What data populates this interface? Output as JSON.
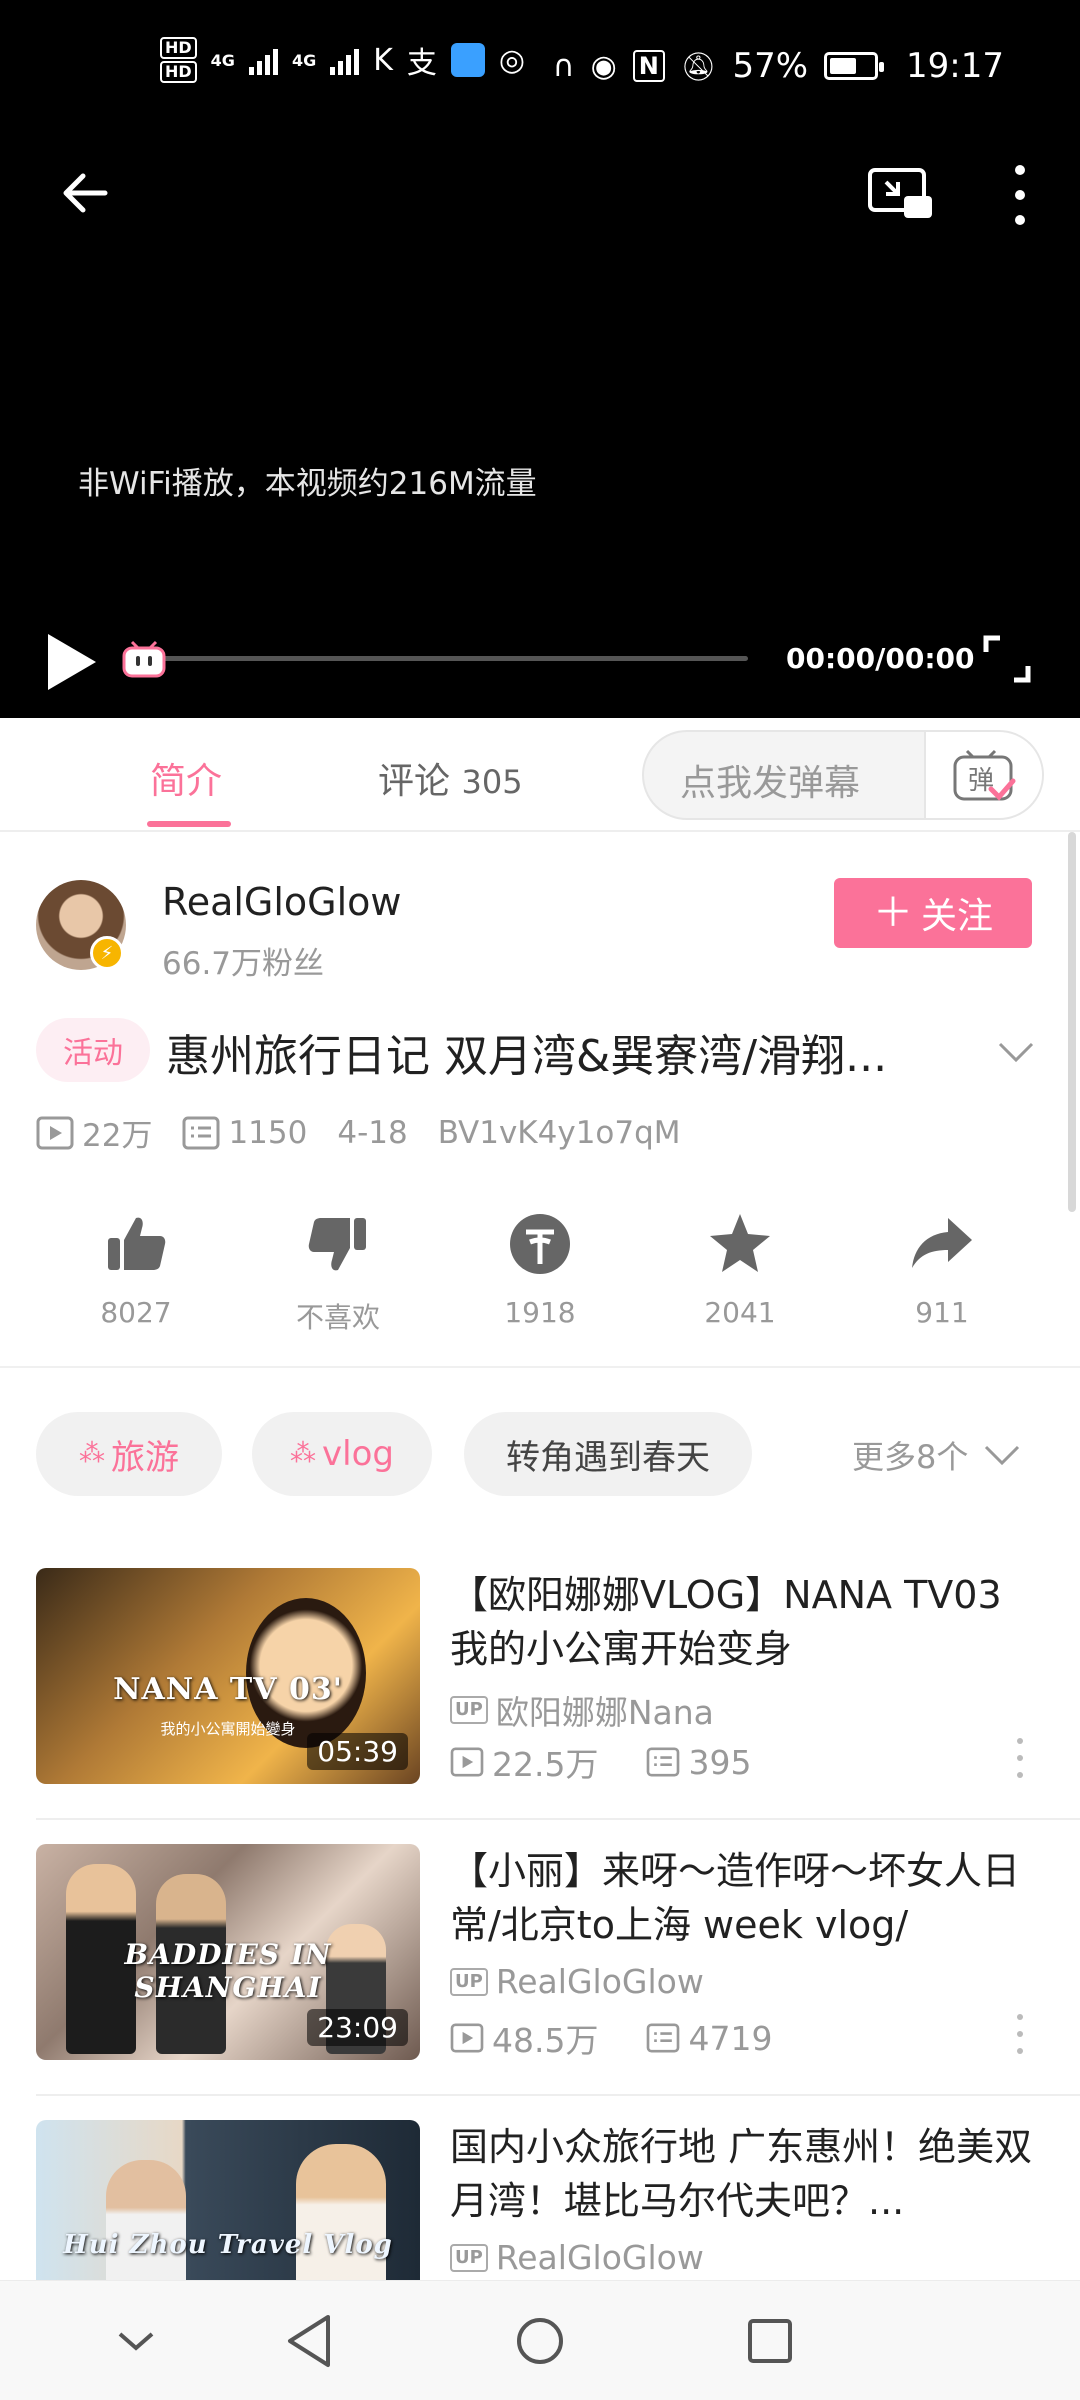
{
  "status_bar": {
    "network_labels": [
      "4G",
      "4G"
    ],
    "battery_percent": "57%",
    "time": "19:17"
  },
  "player": {
    "network_notice": "非WiFi播放，本视频约216M流量",
    "time_display": "00:00/00:00",
    "progress": 0
  },
  "tabs": {
    "intro_label": "简介",
    "comments_label": "评论",
    "comments_count": "305",
    "danmaku_placeholder": "点我发弹幕",
    "danmaku_icon_label": "弹"
  },
  "uploader": {
    "name": "RealGloGlow",
    "fans": "66.7万粉丝",
    "follow_label": "关注"
  },
  "video": {
    "activity_tag": "活动",
    "title": "惠州旅行日记 双月湾&巽寮湾/滑翔...",
    "views": "22万",
    "danmaku_count": "1150",
    "date": "4-18",
    "bvid": "BV1vK4y1o7qM"
  },
  "actions": {
    "like": "8027",
    "dislike": "不喜欢",
    "coin": "1918",
    "favorite": "2041",
    "share": "911"
  },
  "tags": {
    "items": [
      "旅游",
      "vlog",
      "转角遇到春天"
    ],
    "more_label": "更多8个"
  },
  "related": [
    {
      "title": "【欧阳娜娜VLOG】NANA TV03 我的小公寓开始变身",
      "up": "欧阳娜娜Nana",
      "views": "22.5万",
      "danmaku": "395",
      "duration": "05:39",
      "thumb_caption": "NANA TV 03'",
      "thumb_sub": "我的小公寓開始變身"
    },
    {
      "title": "【小丽】来呀～造作呀～坏女人日常/北京to上海 week vlog/",
      "up": "RealGloGlow",
      "views": "48.5万",
      "danmaku": "4719",
      "duration": "23:09",
      "thumb_caption": "BADDIES IN SHANGHAI"
    },
    {
      "title": "国内小众旅行地 广东惠州！绝美双月湾！堪比马尔代夫吧？...",
      "up": "RealGloGlow",
      "thumb_caption": "Hui Zhou Travel Vlog"
    }
  ],
  "up_badge_label": "UP",
  "colors": {
    "accent": "#fb7299",
    "player_bg": "#000000",
    "secondary_text": "#999999"
  }
}
